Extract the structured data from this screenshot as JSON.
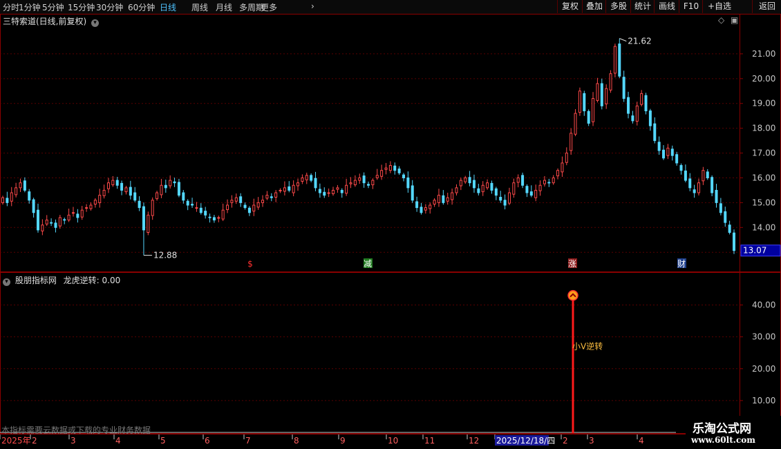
{
  "toolbar": {
    "periods": [
      "分时",
      "1分钟",
      "5分钟",
      "15分钟",
      "30分钟",
      "60分钟",
      "日线",
      "周线",
      "月线",
      "多周期",
      "更多"
    ],
    "active_period": "日线",
    "right_buttons": [
      "复权",
      "叠加",
      "多股",
      "统计",
      "画线",
      "F10",
      "+自选",
      "返回"
    ]
  },
  "main": {
    "title": "三特索道(日线,前复权)",
    "high_label": "21.62",
    "low_label": "12.88",
    "current_price": "13.07",
    "markers": [
      {
        "text": "$",
        "color": "#ff3030",
        "box": false
      },
      {
        "text": "减",
        "color": "#ffffff",
        "box": true,
        "bg": "#1f7a1f"
      },
      {
        "text": "涨",
        "color": "#ffffff",
        "box": true,
        "bg": "#8b1a1a"
      },
      {
        "text": "财",
        "color": "#ffffff",
        "box": true,
        "bg": "#1f3f8b"
      }
    ],
    "y_ticks": [
      "13.00",
      "14.00",
      "15.00",
      "16.00",
      "17.00",
      "18.00",
      "19.00",
      "20.00",
      "21.00"
    ]
  },
  "indicator": {
    "title": "股朋指标网",
    "value_label": "龙虎逆转: 0.00",
    "signal_text": "小V逆转",
    "note": "本指标需要云数据或下载的专业财务数据",
    "y_ticks": [
      "10.00",
      "20.00",
      "30.00",
      "40.00"
    ]
  },
  "time_axis": {
    "labels": [
      "2025年",
      "2",
      "3",
      "4",
      "5",
      "6",
      "7",
      "8",
      "9",
      "10",
      "11",
      "12",
      "2025/12/18/四",
      "2",
      "3",
      "4"
    ]
  },
  "logo": {
    "name": "乐淘公式网",
    "url": "www.60lt.com"
  },
  "chart_data": {
    "type": "candlestick",
    "title": "三特索道(日线,前复权)",
    "ylim": [
      12.7,
      22.0
    ],
    "high": 21.62,
    "low": 12.88,
    "last": 13.07,
    "closes": [
      15.2,
      15.0,
      15.4,
      15.6,
      15.8,
      15.5,
      15.1,
      14.6,
      13.9,
      14.1,
      14.3,
      14.2,
      14.0,
      14.4,
      14.3,
      14.5,
      14.6,
      14.4,
      14.7,
      14.8,
      14.9,
      15.1,
      15.3,
      15.5,
      15.8,
      15.9,
      15.7,
      15.5,
      15.6,
      15.3,
      15.1,
      14.8,
      13.9,
      14.5,
      15.1,
      15.4,
      15.7,
      15.6,
      15.9,
      15.8,
      15.3,
      15.1,
      14.9,
      14.9,
      14.8,
      14.6,
      14.5,
      14.4,
      14.3,
      14.4,
      14.7,
      14.9,
      15.1,
      15.2,
      15.0,
      14.8,
      14.6,
      14.9,
      15.0,
      15.1,
      15.3,
      15.2,
      15.4,
      15.5,
      15.6,
      15.5,
      15.7,
      15.8,
      16.0,
      16.1,
      15.9,
      15.6,
      15.4,
      15.3,
      15.4,
      15.5,
      15.6,
      15.4,
      15.7,
      15.8,
      15.9,
      16.0,
      15.8,
      15.7,
      15.9,
      16.1,
      16.3,
      16.4,
      16.5,
      16.3,
      16.2,
      16.0,
      15.6,
      15.1,
      14.8,
      14.6,
      14.8,
      14.9,
      15.1,
      15.3,
      15.0,
      15.2,
      15.4,
      15.6,
      15.9,
      16.0,
      15.8,
      15.6,
      15.4,
      15.7,
      15.8,
      15.5,
      15.3,
      15.1,
      14.9,
      15.4,
      15.8,
      16.0,
      15.7,
      15.4,
      15.3,
      15.5,
      15.7,
      15.9,
      15.8,
      16.0,
      16.3,
      16.6,
      17.0,
      17.8,
      18.6,
      19.5,
      18.7,
      18.2,
      19.2,
      19.8,
      18.9,
      19.6,
      20.2,
      21.3,
      20.1,
      19.2,
      18.6,
      18.3,
      18.9,
      19.4,
      18.7,
      18.1,
      17.5,
      17.1,
      16.8,
      17.2,
      16.9,
      16.6,
      16.3,
      15.9,
      15.6,
      15.4,
      15.8,
      16.3,
      16.0,
      15.4,
      15.0,
      14.6,
      14.2,
      13.8,
      13.07
    ]
  }
}
